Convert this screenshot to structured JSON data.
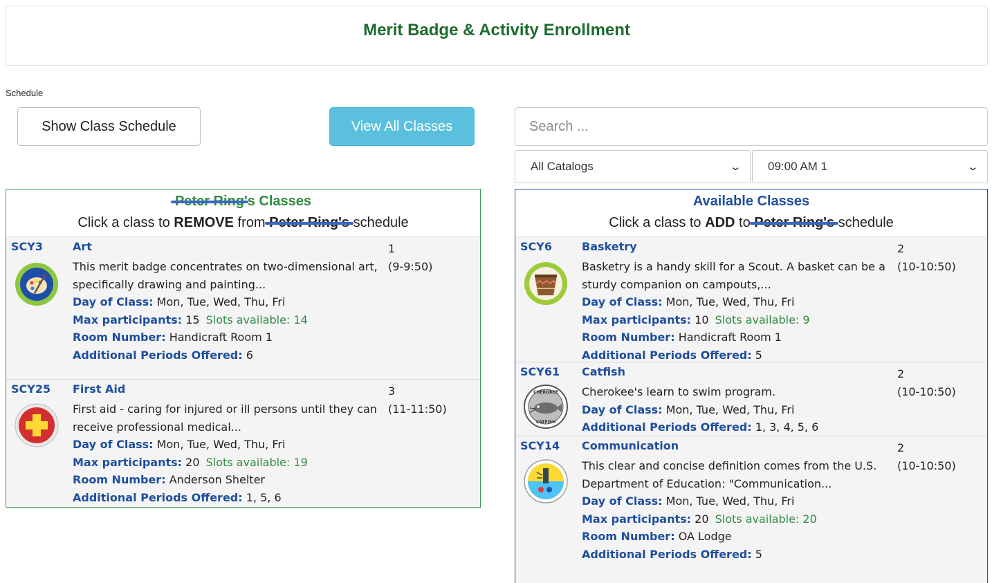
{
  "header": {
    "title": "Merit Badge & Activity Enrollment"
  },
  "schedule_label": "Schedule",
  "toolbar": {
    "show_schedule_label": "Show Class Schedule",
    "view_all_label": "View All Classes"
  },
  "search": {
    "placeholder": "Search ..."
  },
  "filters": {
    "catalog": "All Catalogs",
    "period": "09:00 AM 1"
  },
  "colors": {
    "accent_green": "#2e8b3e",
    "accent_blue": "#1f4e9c",
    "button_info": "#5bc0de"
  },
  "my_classes": {
    "title_suffix": "'s Classes",
    "title_name_redacted": "Peter Ring",
    "instruction_prefix": "Click a class to",
    "instruction_action": "REMOVE",
    "instruction_mid": "from",
    "instruction_name_redacted": "Peter Ring's",
    "instruction_suffix": "schedule",
    "classes": [
      {
        "code": "SCY3",
        "name": "Art",
        "icon": "art-palette-badge-icon",
        "desc": "This merit badge concentrates on two-dimensional art, specifically drawing and painting...",
        "day_label": "Day of Class:",
        "days": "Mon, Tue, Wed, Thu, Fri",
        "max_label": "Max participants:",
        "max": "15",
        "slots": "Slots available: 14",
        "room_label": "Room Number:",
        "room": "Handicraft Room 1",
        "addl_label": "Additional Periods Offered:",
        "addl": "6",
        "period": "1",
        "time": "(9-9:50)"
      },
      {
        "code": "SCY25",
        "name": "First Aid",
        "icon": "first-aid-cross-badge-icon",
        "desc": "First aid - caring for injured or ill persons until they can receive professional medical...",
        "day_label": "Day of Class:",
        "days": "Mon, Tue, Wed, Thu, Fri",
        "max_label": "Max participants:",
        "max": "20",
        "slots": "Slots available: 19",
        "room_label": "Room Number:",
        "room": "Anderson Shelter",
        "addl_label": "Additional Periods Offered:",
        "addl": "1, 5, 6",
        "period": "3",
        "time": "(11-11:50)"
      }
    ]
  },
  "available_classes": {
    "title": "Available Classes",
    "instruction_prefix": "Click a class to",
    "instruction_action": "ADD",
    "instruction_mid": "to",
    "instruction_name_redacted": "Peter Ring's",
    "instruction_suffix": "schedule",
    "classes": [
      {
        "code": "SCY6",
        "name": "Basketry",
        "icon": "basket-badge-icon",
        "desc": "Basketry is a handy skill for a Scout. A basket can be a sturdy companion on campouts,...",
        "day_label": "Day of Class:",
        "days": "Mon, Tue, Wed, Thu, Fri",
        "max_label": "Max participants:",
        "max": "10",
        "slots": "Slots available: 9",
        "room_label": "Room Number:",
        "room": "Handicraft Room 1",
        "addl_label": "Additional Periods Offered:",
        "addl": "5",
        "period": "2",
        "time": "(10-10:50)"
      },
      {
        "code": "SCY61",
        "name": "Catfish",
        "icon": "catfish-patch-icon",
        "badge_text_top": "CHEROKEE",
        "badge_text_bottom": "CATFISH",
        "desc": "Cherokee's learn to swim program.",
        "day_label": "Day of Class:",
        "days": "Mon, Tue, Wed, Thu, Fri",
        "addl_label": "Additional Periods Offered:",
        "addl": "1, 3, 4, 5, 6",
        "period": "2",
        "time": "(10-10:50)"
      },
      {
        "code": "SCY14",
        "name": "Communication",
        "icon": "communication-badge-icon",
        "desc": "This clear and concise definition comes from the U.S. Department of Education: \"Communication...",
        "day_label": "Day of Class:",
        "days": "Mon, Tue, Wed, Thu, Fri",
        "max_label": "Max participants:",
        "max": "20",
        "slots": "Slots available: 20",
        "room_label": "Room Number:",
        "room": "OA Lodge",
        "addl_label": "Additional Periods Offered:",
        "addl": "5",
        "period": "2",
        "time": "(10-10:50)"
      }
    ]
  }
}
